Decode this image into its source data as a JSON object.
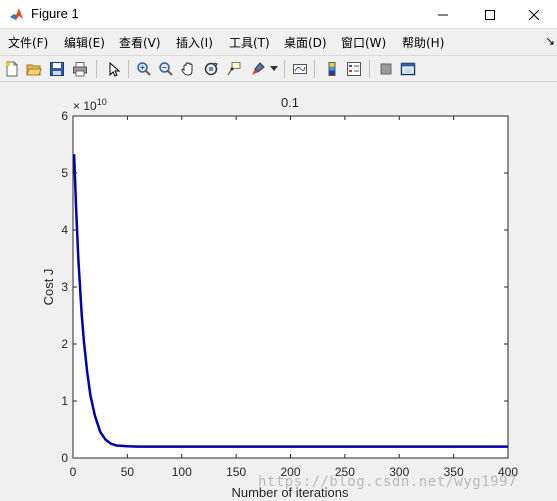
{
  "window": {
    "title": "Figure 1",
    "controls": [
      "minimize",
      "maximize",
      "close"
    ]
  },
  "menu": {
    "items": [
      "文件(F)",
      "编辑(E)",
      "查看(V)",
      "插入(I)",
      "工具(T)",
      "桌面(D)",
      "窗口(W)",
      "帮助(H)"
    ],
    "overflow": "↘"
  },
  "toolbar": {
    "buttons": [
      "new-figure-icon",
      "open-file-icon",
      "save-icon",
      "print-icon",
      "edit-plot-icon",
      "zoom-in-icon",
      "zoom-out-icon",
      "pan-icon",
      "rotate-3d-icon",
      "data-cursor-icon",
      "brush-icon",
      "link-plot-icon",
      "colorbar-icon",
      "legend-icon",
      "hide-plot-tools-icon",
      "show-plot-tools-icon"
    ]
  },
  "chart_data": {
    "type": "line",
    "title": "0.1",
    "xlabel": "Number of iterations",
    "ylabel": "Cost J",
    "xlim": [
      0,
      400
    ],
    "ylim": [
      0,
      6
    ],
    "y_exponent_label": "× 10",
    "y_exponent": "10",
    "xticks": [
      "0",
      "50",
      "100",
      "150",
      "200",
      "250",
      "300",
      "350",
      "400"
    ],
    "yticks": [
      "0",
      "1",
      "2",
      "3",
      "4",
      "5",
      "6"
    ],
    "grid": false,
    "line_color": "#0000aa",
    "series": [
      {
        "x": [
          1,
          3,
          5,
          8,
          10,
          13,
          16,
          20,
          25,
          30,
          35,
          40,
          50,
          60,
          80,
          100,
          150,
          200,
          300,
          400
        ],
        "y": [
          5.33,
          4.3,
          3.47,
          2.52,
          2.05,
          1.52,
          1.1,
          0.75,
          0.46,
          0.32,
          0.25,
          0.22,
          0.205,
          0.2,
          0.2,
          0.2,
          0.2,
          0.2,
          0.2,
          0.2
        ]
      }
    ]
  },
  "watermark": "https://blog.csdn.net/wyg1997"
}
